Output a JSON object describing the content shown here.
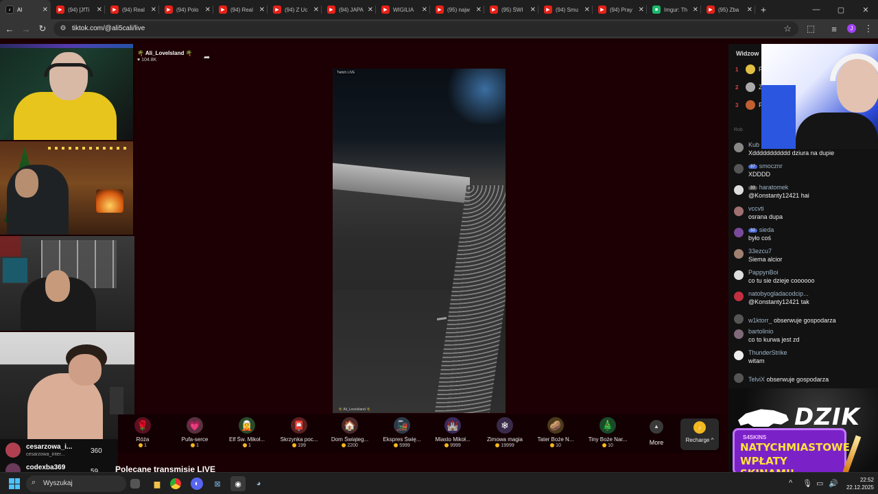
{
  "browser": {
    "tabs": [
      {
        "title": "Al",
        "fav": "tt",
        "icon": "tiktok-icon",
        "active": true
      },
      {
        "title": "(94) [JfTi",
        "fav": "yt",
        "icon": "youtube-icon"
      },
      {
        "title": "(94) Real",
        "fav": "yt",
        "icon": "youtube-icon"
      },
      {
        "title": "(94) Polo",
        "fav": "yt",
        "icon": "youtube-icon"
      },
      {
        "title": "(94) Real",
        "fav": "yt",
        "icon": "youtube-icon"
      },
      {
        "title": "(94) Z Uc",
        "fav": "yt",
        "icon": "youtube-icon"
      },
      {
        "title": "(94) JAPA",
        "fav": "yt",
        "icon": "youtube-icon"
      },
      {
        "title": "WIGILIA",
        "fav": "yt",
        "icon": "youtube-icon"
      },
      {
        "title": "(95) najw",
        "fav": "yt",
        "icon": "youtube-icon"
      },
      {
        "title": "(95) ŚWI",
        "fav": "yt",
        "icon": "youtube-icon"
      },
      {
        "title": "(94) Smu",
        "fav": "yt",
        "icon": "youtube-icon"
      },
      {
        "title": "(94) Pray",
        "fav": "yt",
        "icon": "youtube-icon"
      },
      {
        "title": "Imgur: Th",
        "fav": "im",
        "icon": "imgur-icon"
      },
      {
        "title": "(95) Zba",
        "fav": "yt",
        "icon": "youtube-icon"
      }
    ],
    "url": "tiktok.com/@ali5cali/live",
    "profile_initial": "J"
  },
  "stream": {
    "host_name": "🌴 Ali_LoveIsland 🌴",
    "likes": "104.8K",
    "video_tag": "Twitch LIVE",
    "video_watermark": "🌴 Ali_LoveIsland 🌴"
  },
  "viewers_panel": {
    "title": "Widzow",
    "top": [
      {
        "rank": "1",
        "name": "F",
        "color": "#e0c040"
      },
      {
        "rank": "2",
        "name": "Z",
        "color": "#aaaaaa"
      },
      {
        "rank": "3",
        "name": "P",
        "color": "#c06030"
      }
    ],
    "divider": "Rob"
  },
  "chat": [
    {
      "user": "Kub",
      "text": "Xddddddddddd dziura na dupie",
      "badge": "",
      "avatar": "#888888"
    },
    {
      "user": "smocznr",
      "text": "XDDDD",
      "badge": "37",
      "badge_color": "#4b6bd6",
      "avatar": "#555555"
    },
    {
      "user": "haratomek",
      "text": "@Konstanty12421 hai",
      "badge": "33",
      "badge_color": "#555555",
      "avatar": "#dddddd"
    },
    {
      "user": "vccvti",
      "text": "osrana dupa",
      "badge": "",
      "avatar": "#a07070"
    },
    {
      "user": "sieda",
      "text": "było coś",
      "badge": "32",
      "badge_color": "#4b6bd6",
      "avatar": "#7a4a9a"
    },
    {
      "user": "33ezcu7",
      "text": "Siema alcior",
      "badge": "",
      "avatar": "#a08070"
    },
    {
      "user": "PappynBoi",
      "text": "co tu sie dzieje coooooo",
      "badge": "",
      "avatar": "#dddddd"
    },
    {
      "user": "natobyogladacodcip...",
      "text": "@Konstanty12421 tak",
      "badge": "",
      "avatar": "#c03040"
    },
    {
      "user": "w1ktorr_",
      "text": "obserwuje gospodarza",
      "badge": "",
      "avatar": "#555555",
      "inline": true
    },
    {
      "user": "bartolinio",
      "text": "co to kurwa jest zd",
      "badge": "",
      "avatar": "#806a7a"
    },
    {
      "user": "ThunderStrike",
      "text": "witam",
      "badge": "",
      "avatar": "#eeeeee"
    },
    {
      "user": "TelviX",
      "text": "obserwuje gospodarza",
      "badge": "",
      "avatar": "#555555",
      "inline": true
    }
  ],
  "ad": {
    "logo": "DZIK",
    "brand": "S4SKINS",
    "line1": "NATYCHMIASTOWE",
    "line2": "WPŁATY SKINAMI!"
  },
  "gifts": [
    {
      "name": "Róża",
      "price": "1",
      "icon": "rose-icon",
      "glyph": "🌹",
      "bg": "#5a1020"
    },
    {
      "name": "Pufa-serce",
      "price": "1",
      "icon": "heart-pouf-icon",
      "glyph": "💗",
      "bg": "#5a3040"
    },
    {
      "name": "Elf Św. Mikoł...",
      "price": "1",
      "icon": "elf-icon",
      "glyph": "🧝",
      "bg": "#2a4a2a"
    },
    {
      "name": "Skrzynka poc...",
      "price": "199",
      "icon": "mailbox-icon",
      "glyph": "📮",
      "bg": "#5a2020"
    },
    {
      "name": "Dom Świąteg...",
      "price": "2200",
      "icon": "house-icon",
      "glyph": "🏠",
      "bg": "#4a2a2a"
    },
    {
      "name": "Ekspres Świę...",
      "price": "5999",
      "icon": "train-icon",
      "glyph": "🚂",
      "bg": "#2a3a4a"
    },
    {
      "name": "Miasto Mikoł...",
      "price": "9999",
      "icon": "town-icon",
      "glyph": "🏰",
      "bg": "#3a2a5a"
    },
    {
      "name": "Zimowa magia",
      "price": "19999",
      "icon": "winter-magic-icon",
      "glyph": "❄",
      "bg": "#3a2a4a"
    },
    {
      "name": "Tater Boże N...",
      "price": "10",
      "icon": "potato-icon",
      "glyph": "🥔",
      "bg": "#4a3a1a"
    },
    {
      "name": "Tiny Boże Nar...",
      "price": "10",
      "icon": "tiny-icon",
      "glyph": "🎄",
      "bg": "#1a4a2a"
    }
  ],
  "more_label": "More",
  "recharge_label": "Recharge ^",
  "suggested": [
    {
      "name": "cesarzowa_i...",
      "handle": "cesarzowa_inter...",
      "count": "360",
      "avatar": "#b04050"
    },
    {
      "name": "codexba369",
      "handle": "",
      "count": "59",
      "avatar": "#6a3a5a"
    }
  ],
  "recommended_title": "Polecane transmisje LIVE",
  "taskbar": {
    "search_placeholder": "Wyszukaj",
    "time": "22:52",
    "date": "22.12.2025"
  }
}
